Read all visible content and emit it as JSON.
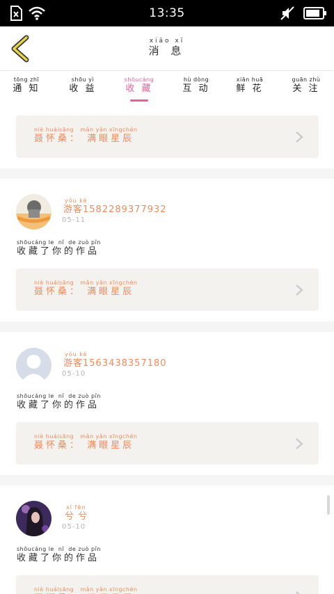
{
  "status": {
    "time": "13:35"
  },
  "header": {
    "title_pinyin": "xiāo xī",
    "title": "消 息"
  },
  "tabs": [
    {
      "pinyin": "tōng zhī",
      "label": "通 知"
    },
    {
      "pinyin": "shōu yì",
      "label": "收 益"
    },
    {
      "pinyin": "shōucáng",
      "label": "收 藏"
    },
    {
      "pinyin": "hù dòng",
      "label": "互 动"
    },
    {
      "pinyin": "xiān huā",
      "label": "鲜 花"
    },
    {
      "pinyin": "guān zhù",
      "label": "关 注"
    }
  ],
  "quote": {
    "pinyin": "niè huáisāng   mǎn yǎn xīngchén",
    "text": "聂怀桑： 满眼星辰"
  },
  "action": {
    "pinyin": "shōucáng le  nǐ  de zuò pǐn",
    "text": "收藏了你的作品"
  },
  "items": [
    {
      "name_pinyin": "yóu kè",
      "name": "游客1582289377932",
      "date": "05-11"
    },
    {
      "name_pinyin": "yóu kè",
      "name": "游客1563438357180",
      "date": "05-10"
    },
    {
      "name_pinyin": "xī fēn",
      "name": "兮 兮",
      "date": "05-10"
    }
  ],
  "colors": {
    "accent": "#e8629a",
    "orange": "#f08a5d"
  }
}
